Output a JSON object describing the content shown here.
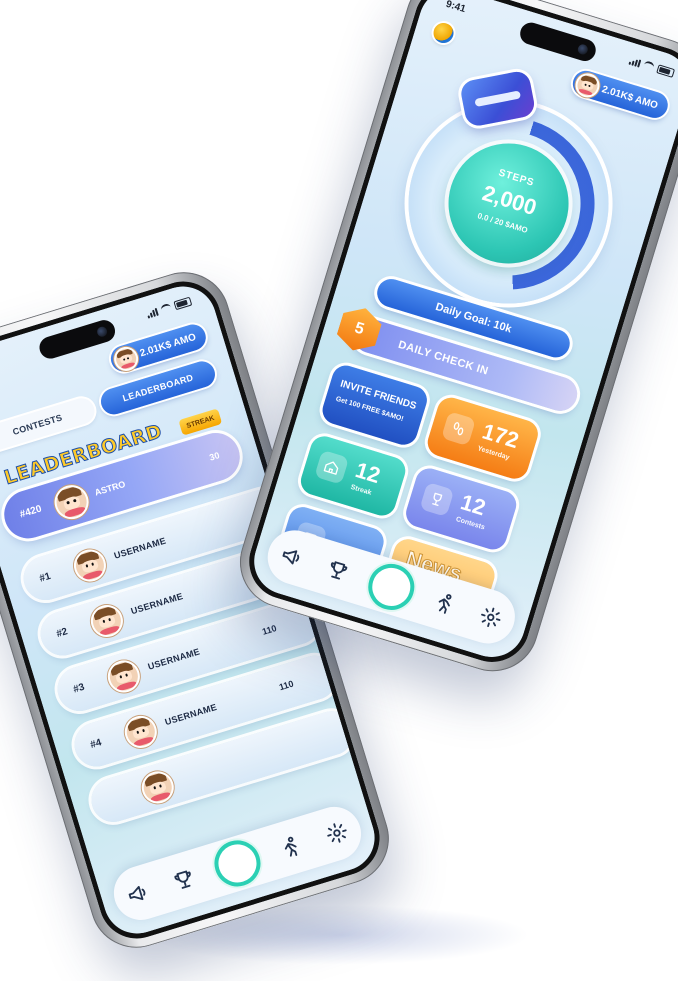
{
  "status": {
    "time": "9:41"
  },
  "wallet": {
    "label": "2.01K$ AMO"
  },
  "leaderboard_screen": {
    "tabs": [
      {
        "label": "CONTESTS"
      },
      {
        "label": "LEADERBOARD"
      }
    ],
    "title": "LEADERBOARD",
    "streak_tag": "STREAK",
    "me": {
      "rank": "#420",
      "name": "ASTRO",
      "value": "30"
    },
    "rows": [
      {
        "rank": "#1",
        "name": "USERNAME",
        "value": ""
      },
      {
        "rank": "#2",
        "name": "USERNAME",
        "value": ""
      },
      {
        "rank": "#3",
        "name": "USERNAME",
        "value": "110"
      },
      {
        "rank": "#4",
        "name": "USERNAME",
        "value": "110"
      }
    ]
  },
  "home_screen": {
    "steps_label": "STEPS",
    "steps_value": "2,000",
    "steps_sub": "0.0 / 20 $AMO",
    "goal": "Daily Goal: 10k",
    "checkin_badge": "5",
    "checkin_label": "DAILY CHECK IN",
    "invite_title": "INVITE FRIENDS",
    "invite_sub": "Get 100 FREE $AMO!",
    "yesterday_value": "172",
    "yesterday_label": "Yesterday",
    "streak_value": "12",
    "streak_label": "Streak",
    "contests_value": "12",
    "contests_label": "Contests",
    "news_label": "News"
  },
  "nav": [
    {
      "icon": "megaphone-icon"
    },
    {
      "icon": "trophy-icon"
    },
    {
      "icon": "home-ring-icon"
    },
    {
      "icon": "runner-icon"
    },
    {
      "icon": "gear-icon"
    }
  ],
  "colors": {
    "accent": "#2664d9",
    "teal": "#2dc6b4",
    "orange": "#f57d15",
    "gold": "#ffca28"
  }
}
